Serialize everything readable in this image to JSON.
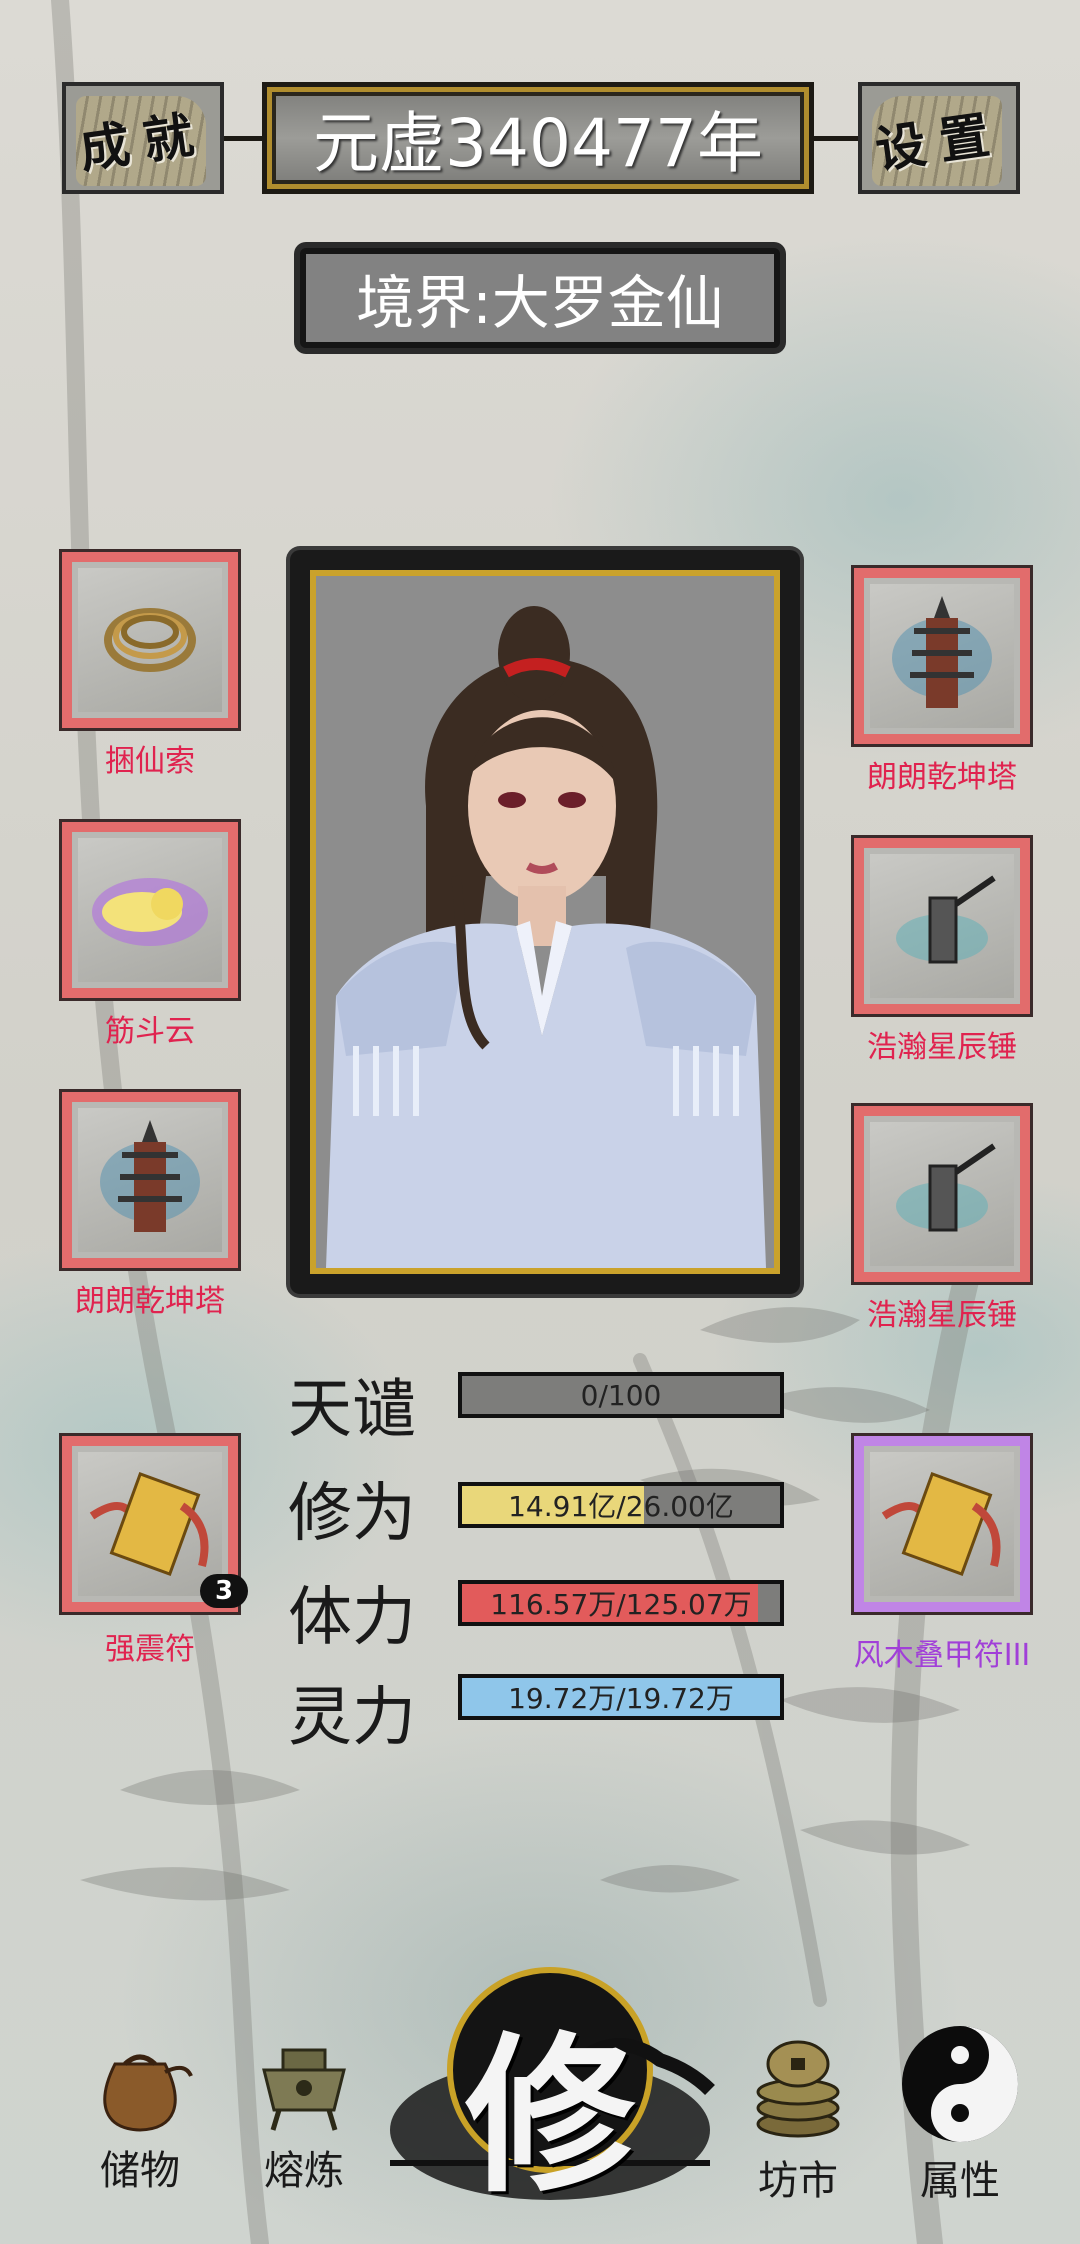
{
  "header": {
    "achievements_label": "成就",
    "year_text": "元虚340477年",
    "settings_label": "设置",
    "realm_text": "境界:大罗金仙"
  },
  "left_items": [
    {
      "name": "捆仙索"
    },
    {
      "name": "筋斗云"
    },
    {
      "name": "朗朗乾坤塔"
    },
    {
      "name": "强震符",
      "count": "3"
    }
  ],
  "right_items": [
    {
      "name": "朗朗乾坤塔"
    },
    {
      "name": "浩瀚星辰锤"
    },
    {
      "name": "浩瀚星辰锤"
    },
    {
      "name": "风木叠甲符III"
    }
  ],
  "stats": [
    {
      "label": "天谴",
      "value_text": "0/100",
      "fraction": 0.0,
      "color": "#7d7d7b"
    },
    {
      "label": "修为",
      "value_text": "14.91亿/26.00亿",
      "fraction": 0.573,
      "color": "#e9d77a"
    },
    {
      "label": "体力",
      "value_text": "116.57万/125.07万",
      "fraction": 0.932,
      "color": "#e25b5b"
    },
    {
      "label": "灵力",
      "value_text": "19.72万/19.72万",
      "fraction": 1.0,
      "color": "#8fc6ea"
    }
  ],
  "bottom_nav": {
    "storage": "储物",
    "smelting": "熔炼",
    "cultivate": "修",
    "market": "坊市",
    "attributes": "属性"
  },
  "colors": {
    "slot_border_red": "#e26c6c",
    "slot_border_purple": "#c085e6",
    "item_name_red": "#e0234f",
    "item_name_purple": "#a13fd8",
    "frame_gold": "#caa22b"
  }
}
